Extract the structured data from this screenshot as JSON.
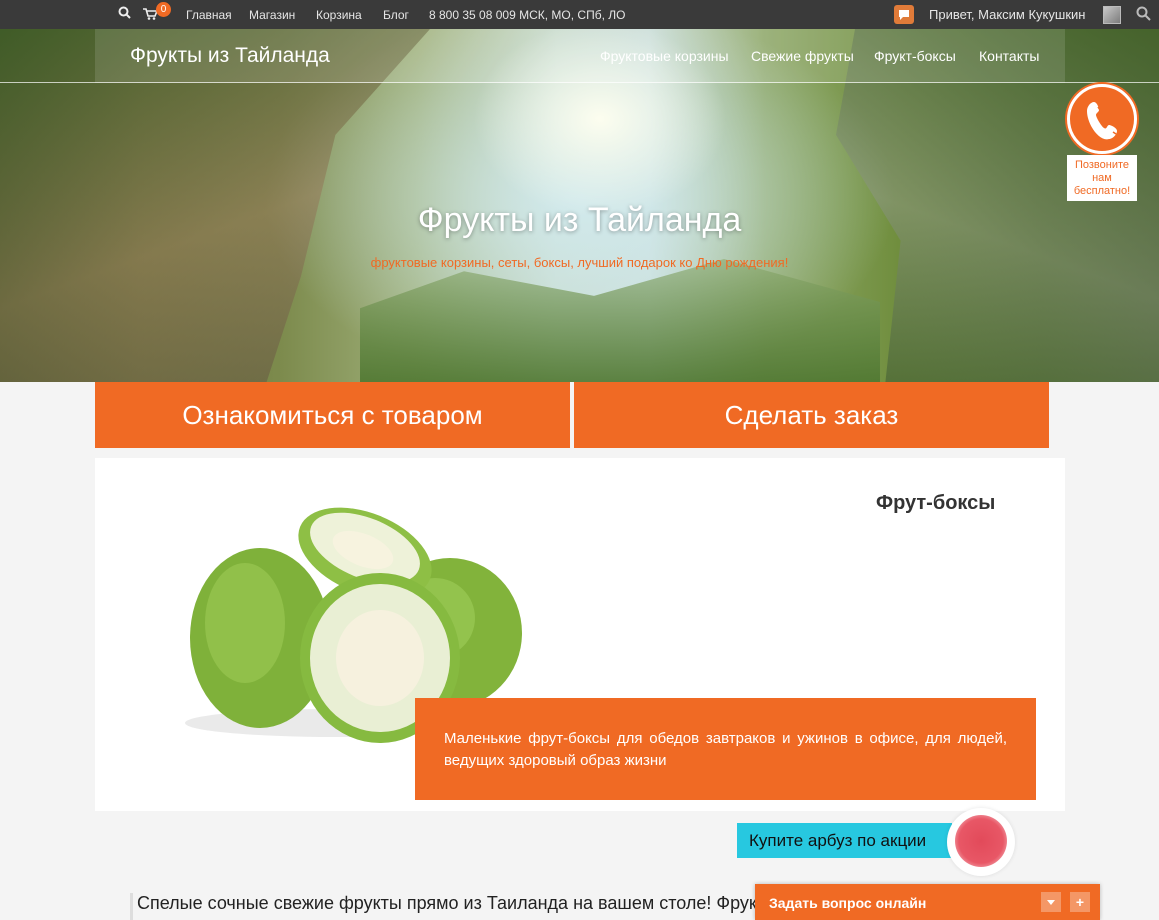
{
  "topbar": {
    "cart_count": "0",
    "links": [
      "Главная",
      "Магазин",
      "Корзина",
      "Блог"
    ],
    "phone": "8 800 35 08 009 МСК, МО, СПб, ЛО",
    "greeting": "Привет, Максим Кукушкин"
  },
  "header": {
    "brand": "Фрукты из Тайланда",
    "nav": [
      "Фруктовые корзины",
      "Свежие фрукты",
      "Фрукт-боксы",
      "Контакты"
    ]
  },
  "hero": {
    "title": "Фрукты из Тайланда",
    "subtitle": "фруктовые корзины, сеты, боксы, лучший подарок ко Дню рождения!"
  },
  "callback": {
    "label": "Позвоните нам бесплатно!"
  },
  "cta": {
    "browse": "Ознакомиться с товаром",
    "order": "Сделать заказ"
  },
  "product": {
    "title": "Фрут-боксы",
    "description": "Маленькие фрут-боксы для обедов завтраков и ужинов в офисе, для людей, ведущих здоровый образ жизни"
  },
  "promo": {
    "text": "Купите арбуз по акции"
  },
  "bottom": {
    "text": "Спелые сочные свежие фрукты прямо из Таиланда на вашем столе! Фрукты"
  },
  "chat": {
    "title": "Задать вопрос онлайн",
    "expand": "+"
  },
  "colors": {
    "accent": "#f06a24",
    "topbar": "#3a3a3a",
    "promo": "#27c8e0"
  }
}
